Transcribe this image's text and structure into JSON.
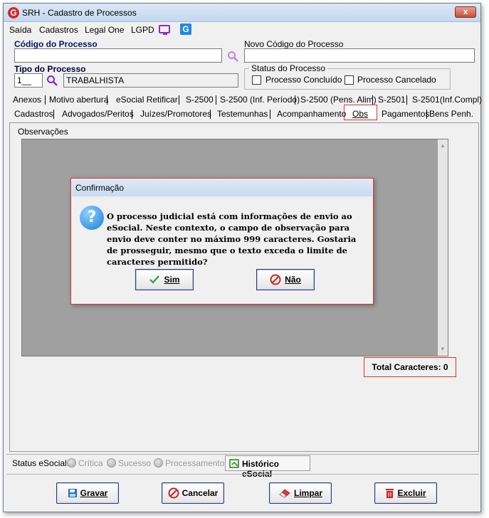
{
  "window": {
    "app_icon": "G",
    "title": "SRH - Cadastro de Processos",
    "close_label": "x"
  },
  "menu": [
    "Saída",
    "Cadastros",
    "Legal One",
    "LGPD"
  ],
  "menu_icons": [
    "monitor-icon",
    "g-icon"
  ],
  "form": {
    "codigo_label": "Código do Processo",
    "codigo_value": "",
    "novo_codigo_label": "Novo Código do Processo",
    "novo_codigo_value": "",
    "tipo_label": "Tipo do Processo",
    "tipo_code": "1__",
    "tipo_desc": "TRABALHISTA",
    "status_group_label": "Status do Processo",
    "concluido_label": "Processo Concluído",
    "cancelado_label": "Processo Cancelado"
  },
  "tabs_row1": [
    "Anexos",
    "Motivo abertura",
    "eSocial Retificar",
    "S-2500",
    "S-2500 (Inf. Período)",
    "S-2500 (Pens. Alim)",
    "S-2501",
    "S-2501(Inf.Compl)"
  ],
  "tabs_row2": [
    "Cadastros",
    "Advogados/Peritos",
    "Juízes/Promotores",
    "Testemunhas",
    "Acompanhamento",
    "Obs",
    "Pagamentos",
    "Bens Penh."
  ],
  "panel": {
    "observacoes_label": "Observações",
    "total_label": "Total Caracteres: 0"
  },
  "status_bar": {
    "label": "Status eSocial:",
    "options": [
      "Crítica",
      "Sucesso",
      "Processamento"
    ],
    "historico_tab": "Histórico eSocial"
  },
  "footer": {
    "gravar": "Gravar",
    "cancelar": "Cancelar",
    "limpar": "Limpar",
    "excluir": "Excluir"
  },
  "dialog": {
    "title": "Confirmação",
    "icon": "?",
    "message": "O processo judicial está com informações de envio ao eSocial. Neste contexto, o campo de observação para envio deve conter no máximo 999 caracteres. Gostaria de prosseguir, mesmo que o texto exceda o limite de caracteres permitido?",
    "yes": "Sim",
    "no": "Não"
  },
  "colors": {
    "highlight_red": "#dd3333",
    "accent_blue": "#1e88e5",
    "magnifier_purple": "#7a2bd6"
  }
}
